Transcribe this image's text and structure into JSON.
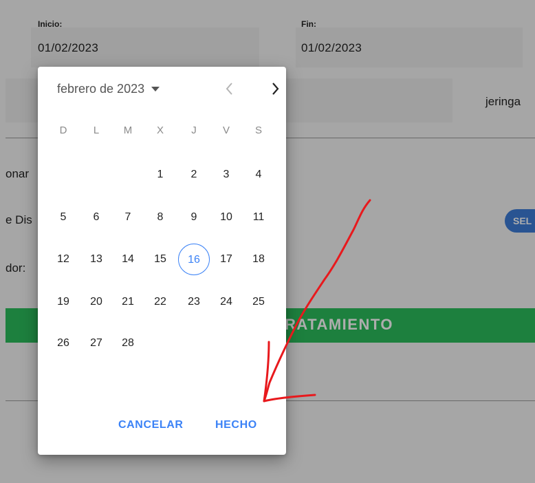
{
  "form": {
    "start_label": "Inicio:",
    "start_value": "01/02/2023",
    "end_label": "Fin:",
    "end_value": "01/02/2023",
    "side_text_right": "jeringa",
    "row_label_1": "onar",
    "row_label_2": "e Dis",
    "row_label_3": "dor:",
    "select_button_label": "SEL",
    "green_button_label": "RATAMIENTO"
  },
  "datepicker": {
    "month_label": "febrero de 2023",
    "weekdays": [
      "D",
      "L",
      "M",
      "X",
      "J",
      "V",
      "S"
    ],
    "weeks": [
      [
        "",
        "",
        "",
        "1",
        "2",
        "3",
        "4"
      ],
      [
        "5",
        "6",
        "7",
        "8",
        "9",
        "10",
        "11"
      ],
      [
        "12",
        "13",
        "14",
        "15",
        "16",
        "17",
        "18"
      ],
      [
        "19",
        "20",
        "21",
        "22",
        "23",
        "24",
        "25"
      ],
      [
        "26",
        "27",
        "28",
        "",
        "",
        "",
        ""
      ]
    ],
    "today": "16",
    "cancel_label": "CANCELAR",
    "done_label": "HECHO"
  },
  "colors": {
    "accent": "#3b82f6",
    "green": "#2bbd5c",
    "annotation": "#e8191d"
  }
}
